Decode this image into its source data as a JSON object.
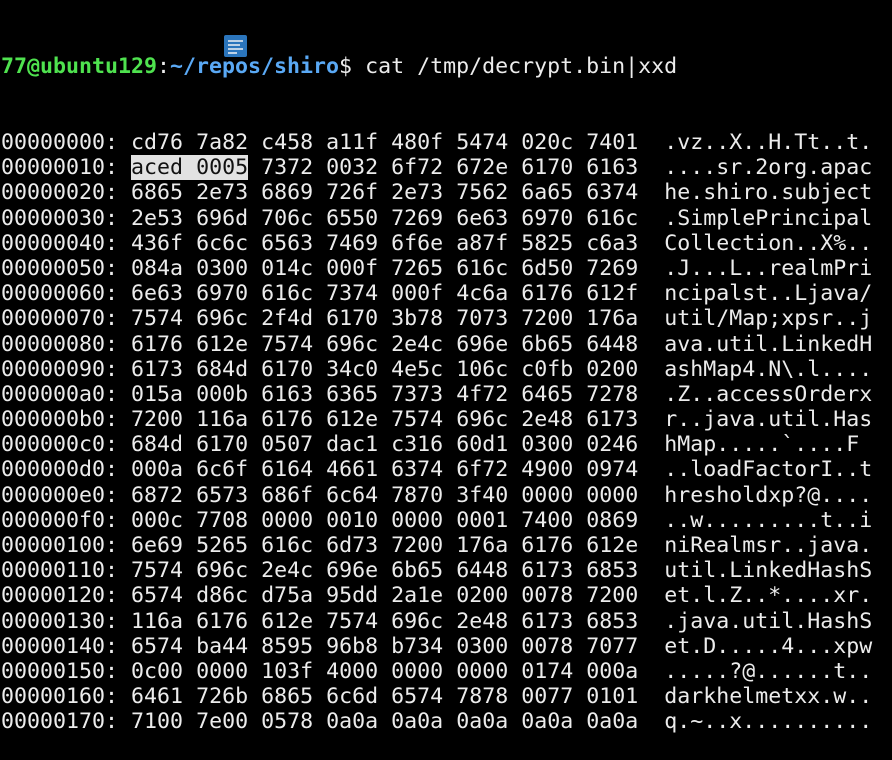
{
  "prompt": {
    "user_host": "77@ubuntu129",
    "separator": ":",
    "path": "~/repos/shiro",
    "symbol": "$ ",
    "command": "cat /tmp/decrypt.bin|xxd"
  },
  "selection": {
    "offset": "00000010",
    "text": "aced 0005"
  },
  "overlay_icon": "floating-toolbar-icon",
  "colors": {
    "user": "#4fe24f",
    "path": "#5aa9f5",
    "text": "#ececec",
    "background": "#000000",
    "selection": "#e2e2e2"
  },
  "rows": [
    {
      "offset": "00000000",
      "hex": [
        "cd76",
        "7a82",
        "c458",
        "a11f",
        "480f",
        "5474",
        "020c",
        "7401"
      ],
      "ascii": ".vz..X..H.Tt..t."
    },
    {
      "offset": "00000010",
      "hex": [
        "aced",
        "0005",
        "7372",
        "0032",
        "6f72",
        "672e",
        "6170",
        "6163"
      ],
      "ascii": "....sr.2org.apac"
    },
    {
      "offset": "00000020",
      "hex": [
        "6865",
        "2e73",
        "6869",
        "726f",
        "2e73",
        "7562",
        "6a65",
        "6374"
      ],
      "ascii": "he.shiro.subject"
    },
    {
      "offset": "00000030",
      "hex": [
        "2e53",
        "696d",
        "706c",
        "6550",
        "7269",
        "6e63",
        "6970",
        "616c"
      ],
      "ascii": ".SimplePrincipal"
    },
    {
      "offset": "00000040",
      "hex": [
        "436f",
        "6c6c",
        "6563",
        "7469",
        "6f6e",
        "a87f",
        "5825",
        "c6a3"
      ],
      "ascii": "Collection..X%.."
    },
    {
      "offset": "00000050",
      "hex": [
        "084a",
        "0300",
        "014c",
        "000f",
        "7265",
        "616c",
        "6d50",
        "7269"
      ],
      "ascii": ".J...L..realmPri"
    },
    {
      "offset": "00000060",
      "hex": [
        "6e63",
        "6970",
        "616c",
        "7374",
        "000f",
        "4c6a",
        "6176",
        "612f"
      ],
      "ascii": "ncipalst..Ljava/"
    },
    {
      "offset": "00000070",
      "hex": [
        "7574",
        "696c",
        "2f4d",
        "6170",
        "3b78",
        "7073",
        "7200",
        "176a"
      ],
      "ascii": "util/Map;xpsr..j"
    },
    {
      "offset": "00000080",
      "hex": [
        "6176",
        "612e",
        "7574",
        "696c",
        "2e4c",
        "696e",
        "6b65",
        "6448"
      ],
      "ascii": "ava.util.LinkedH"
    },
    {
      "offset": "00000090",
      "hex": [
        "6173",
        "684d",
        "6170",
        "34c0",
        "4e5c",
        "106c",
        "c0fb",
        "0200"
      ],
      "ascii": "ashMap4.N\\.l...."
    },
    {
      "offset": "000000a0",
      "hex": [
        "015a",
        "000b",
        "6163",
        "6365",
        "7373",
        "4f72",
        "6465",
        "7278"
      ],
      "ascii": ".Z..accessOrderx"
    },
    {
      "offset": "000000b0",
      "hex": [
        "7200",
        "116a",
        "6176",
        "612e",
        "7574",
        "696c",
        "2e48",
        "6173"
      ],
      "ascii": "r..java.util.Has"
    },
    {
      "offset": "000000c0",
      "hex": [
        "684d",
        "6170",
        "0507",
        "dac1",
        "c316",
        "60d1",
        "0300",
        "0246"
      ],
      "ascii": "hMap.....`....F"
    },
    {
      "offset": "000000d0",
      "hex": [
        "000a",
        "6c6f",
        "6164",
        "4661",
        "6374",
        "6f72",
        "4900",
        "0974"
      ],
      "ascii": "..loadFactorI..t"
    },
    {
      "offset": "000000e0",
      "hex": [
        "6872",
        "6573",
        "686f",
        "6c64",
        "7870",
        "3f40",
        "0000",
        "0000"
      ],
      "ascii": "hresholdxp?@...."
    },
    {
      "offset": "000000f0",
      "hex": [
        "000c",
        "7708",
        "0000",
        "0010",
        "0000",
        "0001",
        "7400",
        "0869"
      ],
      "ascii": "..w.........t..i"
    },
    {
      "offset": "00000100",
      "hex": [
        "6e69",
        "5265",
        "616c",
        "6d73",
        "7200",
        "176a",
        "6176",
        "612e"
      ],
      "ascii": "niRealmsr..java."
    },
    {
      "offset": "00000110",
      "hex": [
        "7574",
        "696c",
        "2e4c",
        "696e",
        "6b65",
        "6448",
        "6173",
        "6853"
      ],
      "ascii": "util.LinkedHashS"
    },
    {
      "offset": "00000120",
      "hex": [
        "6574",
        "d86c",
        "d75a",
        "95dd",
        "2a1e",
        "0200",
        "0078",
        "7200"
      ],
      "ascii": "et.l.Z..*....xr."
    },
    {
      "offset": "00000130",
      "hex": [
        "116a",
        "6176",
        "612e",
        "7574",
        "696c",
        "2e48",
        "6173",
        "6853"
      ],
      "ascii": ".java.util.HashS"
    },
    {
      "offset": "00000140",
      "hex": [
        "6574",
        "ba44",
        "8595",
        "96b8",
        "b734",
        "0300",
        "0078",
        "7077"
      ],
      "ascii": "et.D.....4...xpw"
    },
    {
      "offset": "00000150",
      "hex": [
        "0c00",
        "0000",
        "103f",
        "4000",
        "0000",
        "0000",
        "0174",
        "000a"
      ],
      "ascii": ".....?@......t.."
    },
    {
      "offset": "00000160",
      "hex": [
        "6461",
        "726b",
        "6865",
        "6c6d",
        "6574",
        "7878",
        "0077",
        "0101"
      ],
      "ascii": "darkhelmetxx.w.."
    },
    {
      "offset": "00000170",
      "hex": [
        "7100",
        "7e00",
        "0578",
        "0a0a",
        "0a0a",
        "0a0a",
        "0a0a",
        "0a0a"
      ],
      "ascii": "q.~..x.........."
    }
  ]
}
